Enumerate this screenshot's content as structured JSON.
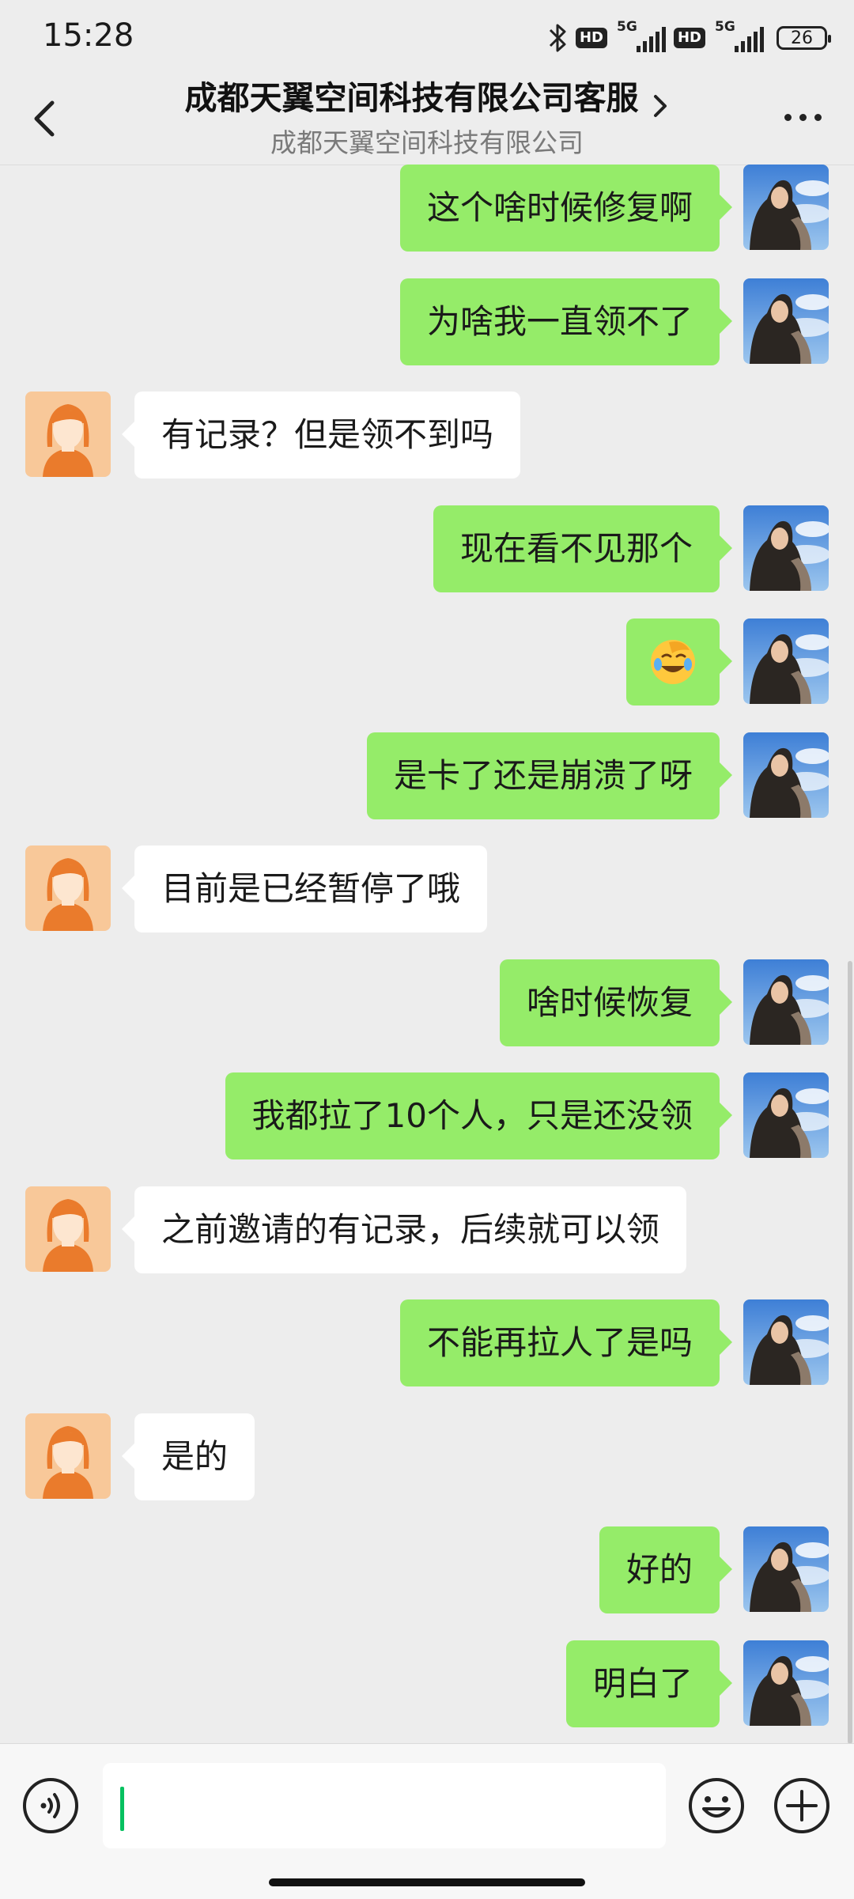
{
  "status_bar": {
    "time": "15:28",
    "hd_label": "HD",
    "network_label": "5G",
    "battery": "26",
    "icons": [
      "bluetooth-icon",
      "signal-icon",
      "battery-icon"
    ]
  },
  "header": {
    "title": "成都天翼空间科技有限公司客服",
    "subtitle": "成都天翼空间科技有限公司",
    "icons": [
      "back-arrow-icon",
      "chevron-right-icon",
      "more-icon"
    ]
  },
  "messages": [
    {
      "side": "right",
      "text": "这个啥时候修复啊"
    },
    {
      "side": "right",
      "text": "为啥我一直领不了"
    },
    {
      "side": "left",
      "text": "有记录？但是领不到吗"
    },
    {
      "side": "right",
      "text": "现在看不见那个"
    },
    {
      "side": "right",
      "text": "",
      "emoji": "facepalm-laugh-emoji"
    },
    {
      "side": "right",
      "text": "是卡了还是崩溃了呀"
    },
    {
      "side": "left",
      "text": "目前是已经暂停了哦"
    },
    {
      "side": "right",
      "text": "啥时候恢复"
    },
    {
      "side": "right",
      "text": "我都拉了10个人，只是还没领"
    },
    {
      "side": "left",
      "text": "之前邀请的有记录，后续就可以领"
    },
    {
      "side": "right",
      "text": "不能再拉人了是吗"
    },
    {
      "side": "left",
      "text": "是的"
    },
    {
      "side": "right",
      "text": "好的"
    },
    {
      "side": "right",
      "text": "明白了"
    }
  ],
  "input_bar": {
    "value": "",
    "icons": [
      "voice-icon",
      "emoji-icon",
      "plus-icon"
    ]
  },
  "colors": {
    "background": "#ededed",
    "sent_bubble": "#95ec69",
    "received_bubble": "#ffffff",
    "accent": "#07c160"
  }
}
